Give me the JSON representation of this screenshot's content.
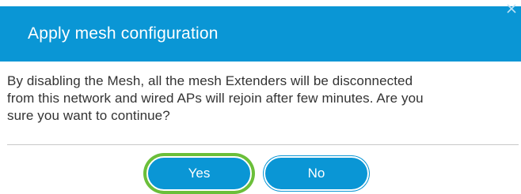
{
  "dialog": {
    "title": "Apply mesh configuration",
    "message_lines": [
      "By disabling the Mesh, all the mesh Extenders will be disconnected",
      "from this network and wired APs will rejoin after few minutes. Are you",
      "sure you want to continue?"
    ],
    "close_icon": "close-icon",
    "buttons": {
      "yes_label": "Yes",
      "no_label": "No"
    }
  },
  "colors": {
    "header": "#0a96d5",
    "button": "#0a96d5",
    "focus_ring": "#6bbf3a",
    "text": "#333333"
  }
}
